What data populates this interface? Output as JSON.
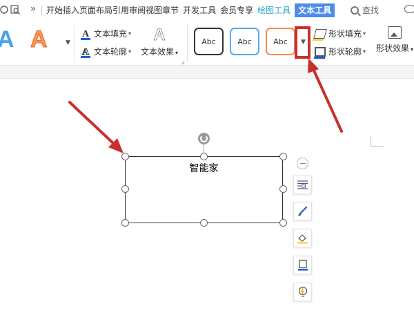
{
  "menubar": {
    "menus": [
      "开始",
      "插入",
      "页面布局",
      "引用",
      "审阅",
      "视图",
      "章节",
      "开发工具",
      "会员专享",
      "绘图工具",
      "文本工具"
    ],
    "active_context_menu": "绘图工具",
    "active_tab": "文本工具",
    "search_label": "查找",
    "overflow_glyph": "»"
  },
  "ribbon": {
    "text_art_samples": [
      "A",
      "A"
    ],
    "text_fill_label": "文本填充",
    "text_outline_label": "文本轮廓",
    "text_effect_label": "文本效果",
    "effect_glyph": "A",
    "shape_styles": [
      "Abc",
      "Abc",
      "Abc"
    ],
    "shape_fill_label": "形状填充",
    "shape_outline_label": "形状轮廓",
    "shape_effect_label": "形状效果",
    "more_glyph": "▼",
    "dropdown_glyph": "▾"
  },
  "colors": {
    "active_tab_bg": "#4d8de8",
    "context_menu_text": "#2aa7c9",
    "highlight_red": "#c9302c",
    "annotation_arrow": "#c9302c",
    "text_fill_underline": "#1e5fd8",
    "text_outline_underline": "#1e5fd8",
    "shape_fill_underline": "#ffd54a",
    "shape_outline_underline": "#1e5fd8"
  },
  "document": {
    "shape_text": "智能家"
  },
  "float_toolbar": {
    "icons": [
      "layout-options-icon",
      "shape-style-brush-icon",
      "shape-fill-icon",
      "shape-outline-icon",
      "smart-tips-bulb-icon"
    ]
  }
}
